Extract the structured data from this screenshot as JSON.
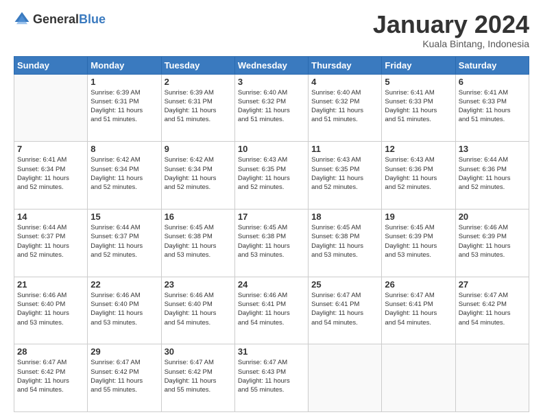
{
  "logo": {
    "general": "General",
    "blue": "Blue"
  },
  "header": {
    "month": "January 2024",
    "location": "Kuala Bintang, Indonesia"
  },
  "days_of_week": [
    "Sunday",
    "Monday",
    "Tuesday",
    "Wednesday",
    "Thursday",
    "Friday",
    "Saturday"
  ],
  "weeks": [
    [
      {
        "day": "",
        "info": ""
      },
      {
        "day": "1",
        "info": "Sunrise: 6:39 AM\nSunset: 6:31 PM\nDaylight: 11 hours\nand 51 minutes."
      },
      {
        "day": "2",
        "info": "Sunrise: 6:39 AM\nSunset: 6:31 PM\nDaylight: 11 hours\nand 51 minutes."
      },
      {
        "day": "3",
        "info": "Sunrise: 6:40 AM\nSunset: 6:32 PM\nDaylight: 11 hours\nand 51 minutes."
      },
      {
        "day": "4",
        "info": "Sunrise: 6:40 AM\nSunset: 6:32 PM\nDaylight: 11 hours\nand 51 minutes."
      },
      {
        "day": "5",
        "info": "Sunrise: 6:41 AM\nSunset: 6:33 PM\nDaylight: 11 hours\nand 51 minutes."
      },
      {
        "day": "6",
        "info": "Sunrise: 6:41 AM\nSunset: 6:33 PM\nDaylight: 11 hours\nand 51 minutes."
      }
    ],
    [
      {
        "day": "7",
        "info": "Sunrise: 6:41 AM\nSunset: 6:34 PM\nDaylight: 11 hours\nand 52 minutes."
      },
      {
        "day": "8",
        "info": "Sunrise: 6:42 AM\nSunset: 6:34 PM\nDaylight: 11 hours\nand 52 minutes."
      },
      {
        "day": "9",
        "info": "Sunrise: 6:42 AM\nSunset: 6:34 PM\nDaylight: 11 hours\nand 52 minutes."
      },
      {
        "day": "10",
        "info": "Sunrise: 6:43 AM\nSunset: 6:35 PM\nDaylight: 11 hours\nand 52 minutes."
      },
      {
        "day": "11",
        "info": "Sunrise: 6:43 AM\nSunset: 6:35 PM\nDaylight: 11 hours\nand 52 minutes."
      },
      {
        "day": "12",
        "info": "Sunrise: 6:43 AM\nSunset: 6:36 PM\nDaylight: 11 hours\nand 52 minutes."
      },
      {
        "day": "13",
        "info": "Sunrise: 6:44 AM\nSunset: 6:36 PM\nDaylight: 11 hours\nand 52 minutes."
      }
    ],
    [
      {
        "day": "14",
        "info": "Sunrise: 6:44 AM\nSunset: 6:37 PM\nDaylight: 11 hours\nand 52 minutes."
      },
      {
        "day": "15",
        "info": "Sunrise: 6:44 AM\nSunset: 6:37 PM\nDaylight: 11 hours\nand 52 minutes."
      },
      {
        "day": "16",
        "info": "Sunrise: 6:45 AM\nSunset: 6:38 PM\nDaylight: 11 hours\nand 53 minutes."
      },
      {
        "day": "17",
        "info": "Sunrise: 6:45 AM\nSunset: 6:38 PM\nDaylight: 11 hours\nand 53 minutes."
      },
      {
        "day": "18",
        "info": "Sunrise: 6:45 AM\nSunset: 6:38 PM\nDaylight: 11 hours\nand 53 minutes."
      },
      {
        "day": "19",
        "info": "Sunrise: 6:45 AM\nSunset: 6:39 PM\nDaylight: 11 hours\nand 53 minutes."
      },
      {
        "day": "20",
        "info": "Sunrise: 6:46 AM\nSunset: 6:39 PM\nDaylight: 11 hours\nand 53 minutes."
      }
    ],
    [
      {
        "day": "21",
        "info": "Sunrise: 6:46 AM\nSunset: 6:40 PM\nDaylight: 11 hours\nand 53 minutes."
      },
      {
        "day": "22",
        "info": "Sunrise: 6:46 AM\nSunset: 6:40 PM\nDaylight: 11 hours\nand 53 minutes."
      },
      {
        "day": "23",
        "info": "Sunrise: 6:46 AM\nSunset: 6:40 PM\nDaylight: 11 hours\nand 54 minutes."
      },
      {
        "day": "24",
        "info": "Sunrise: 6:46 AM\nSunset: 6:41 PM\nDaylight: 11 hours\nand 54 minutes."
      },
      {
        "day": "25",
        "info": "Sunrise: 6:47 AM\nSunset: 6:41 PM\nDaylight: 11 hours\nand 54 minutes."
      },
      {
        "day": "26",
        "info": "Sunrise: 6:47 AM\nSunset: 6:41 PM\nDaylight: 11 hours\nand 54 minutes."
      },
      {
        "day": "27",
        "info": "Sunrise: 6:47 AM\nSunset: 6:42 PM\nDaylight: 11 hours\nand 54 minutes."
      }
    ],
    [
      {
        "day": "28",
        "info": "Sunrise: 6:47 AM\nSunset: 6:42 PM\nDaylight: 11 hours\nand 54 minutes."
      },
      {
        "day": "29",
        "info": "Sunrise: 6:47 AM\nSunset: 6:42 PM\nDaylight: 11 hours\nand 55 minutes."
      },
      {
        "day": "30",
        "info": "Sunrise: 6:47 AM\nSunset: 6:42 PM\nDaylight: 11 hours\nand 55 minutes."
      },
      {
        "day": "31",
        "info": "Sunrise: 6:47 AM\nSunset: 6:43 PM\nDaylight: 11 hours\nand 55 minutes."
      },
      {
        "day": "",
        "info": ""
      },
      {
        "day": "",
        "info": ""
      },
      {
        "day": "",
        "info": ""
      }
    ]
  ]
}
